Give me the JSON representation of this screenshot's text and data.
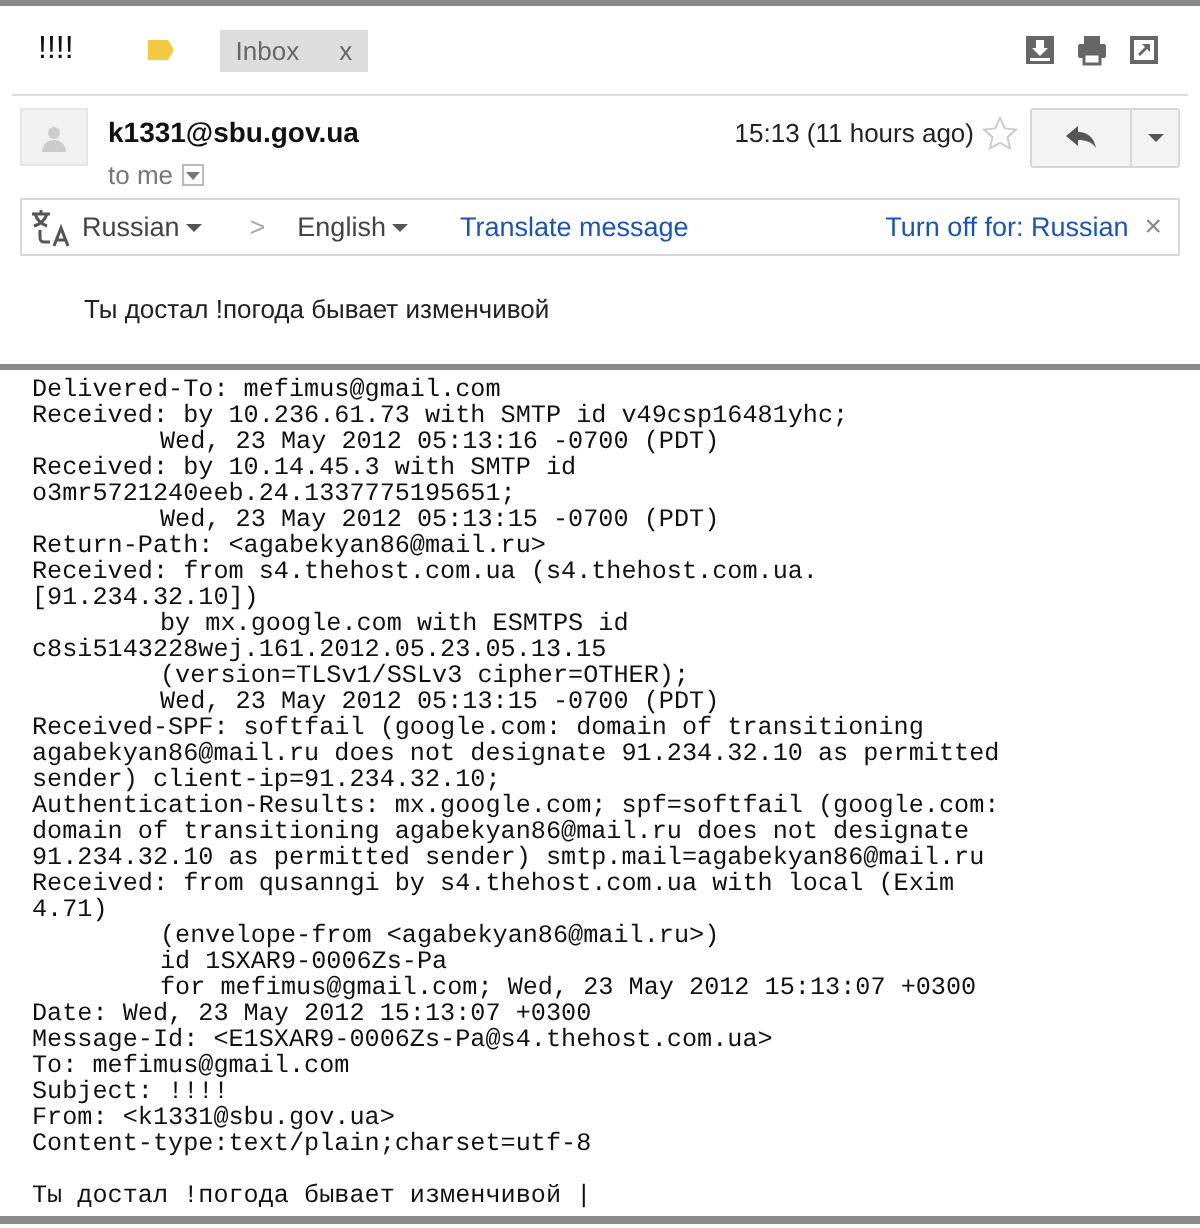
{
  "subject": "!!!!",
  "labels": [
    {
      "name": "Inbox",
      "close": "x"
    }
  ],
  "sender": {
    "email": "k1331@sbu.gov.ua",
    "time": "15:13 (11 hours ago)",
    "starred": false,
    "recipient": "to me"
  },
  "translate_bar": {
    "from": "Russian",
    "to": "English",
    "separator": ">",
    "action": "Translate message",
    "turn_off": "Turn off for: Russian",
    "close": "×"
  },
  "body": "Ты достал !погода бывает изменчивой",
  "raw_source": {
    "lines": [
      {
        "text": "Delivered-To: mefimus@gmail.com"
      },
      {
        "text": "Received: by 10.236.61.73 with SMTP id v49csp16481yhc;",
        "children": [
          {
            "text": "Wed, 23 May 2012 05:13:16 -0700 (PDT)"
          }
        ]
      },
      {
        "text": "Received: by 10.14.45.3 with SMTP id"
      },
      {
        "text": "o3mr5721240eeb.24.1337775195651;",
        "children": [
          {
            "text": "Wed, 23 May 2012 05:13:15 -0700 (PDT)"
          }
        ]
      },
      {
        "text": "Return-Path: <agabekyan86@mail.ru>"
      },
      {
        "text": "Received: from s4.thehost.com.ua (s4.thehost.com.ua."
      },
      {
        "text": "[91.234.32.10])",
        "children": [
          {
            "text": "by mx.google.com with ESMTPS id"
          }
        ]
      },
      {
        "text": "c8si5143228wej.161.2012.05.23.05.13.15",
        "children": [
          {
            "text": "(version=TLSv1/SSLv3 cipher=OTHER);"
          },
          {
            "text": "Wed, 23 May 2012 05:13:15 -0700 (PDT)"
          }
        ]
      },
      {
        "text": "Received-SPF: softfail (google.com: domain of transitioning"
      },
      {
        "text": "agabekyan86@mail.ru does not designate 91.234.32.10 as permitted"
      },
      {
        "text": "sender) client-ip=91.234.32.10;"
      },
      {
        "text": "Authentication-Results: mx.google.com; spf=softfail (google.com:"
      },
      {
        "text": "domain of transitioning agabekyan86@mail.ru does not designate"
      },
      {
        "text": "91.234.32.10 as permitted sender) smtp.mail=agabekyan86@mail.ru"
      },
      {
        "text": "Received: from qusanngi by s4.thehost.com.ua with local (Exim"
      },
      {
        "text": "4.71)",
        "children": [
          {
            "text": "(envelope-from <agabekyan86@mail.ru>)"
          },
          {
            "text": "id 1SXAR9-0006Zs-Pa"
          },
          {
            "text": "for mefimus@gmail.com; Wed, 23 May 2012 15:13:07 +0300"
          }
        ]
      },
      {
        "text": "Date: Wed, 23 May 2012 15:13:07 +0300"
      },
      {
        "text": "Message-Id: <E1SXAR9-0006Zs-Pa@s4.thehost.com.ua>"
      },
      {
        "text": "To: mefimus@gmail.com"
      },
      {
        "text": "Subject: !!!!"
      },
      {
        "text": "From: <k1331@sbu.gov.ua>"
      },
      {
        "text": "Content-type:text/plain;charset=utf-8"
      }
    ],
    "body": "Ты достал !погода бывает изменчивой |"
  }
}
